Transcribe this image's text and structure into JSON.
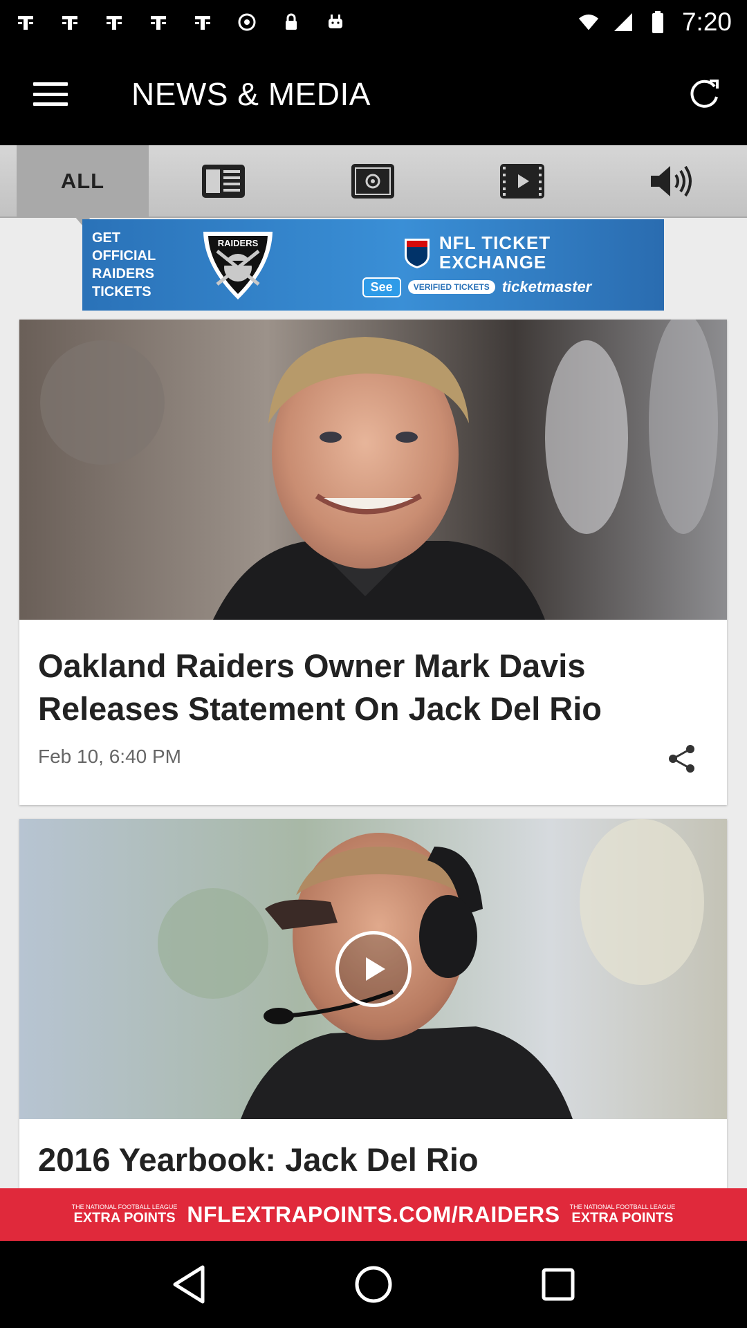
{
  "status_bar": {
    "time": "7:20"
  },
  "header": {
    "title": "NEWS & MEDIA"
  },
  "tabs": [
    {
      "label": "ALL",
      "icon": "all",
      "active": true
    },
    {
      "label": "",
      "icon": "news-icon",
      "active": false
    },
    {
      "label": "",
      "icon": "photo-icon",
      "active": false
    },
    {
      "label": "",
      "icon": "video-icon",
      "active": false
    },
    {
      "label": "",
      "icon": "audio-icon",
      "active": false
    }
  ],
  "ad_banner": {
    "left_text": "GET OFFICIAL RAIDERS TICKETS",
    "shield_text": "RAIDERS",
    "exchange_line1": "NFL TICKET",
    "exchange_line2": "EXCHANGE",
    "see_label": "See",
    "verified_label": "VERIFIED TICKETS",
    "brand": "ticketmaster"
  },
  "articles": [
    {
      "title": "Oakland Raiders Owner Mark Davis Releases Statement On Jack Del Rio",
      "date": "Feb 10, 6:40 PM",
      "is_video": false
    },
    {
      "title": "2016 Yearbook: Jack Del Rio",
      "date": "",
      "is_video": true
    }
  ],
  "bottom_ad": {
    "text": "NFLEXTRAPOINTS.COM/RAIDERS",
    "logo_top": "THE NATIONAL FOOTBALL LEAGUE",
    "logo_main": "EXTRA POINTS"
  },
  "colors": {
    "app_bar": "#000000",
    "tab_active": "#a9a9a9",
    "ad_blue": "#2a72b8",
    "bottom_ad_red": "#e0293b"
  }
}
